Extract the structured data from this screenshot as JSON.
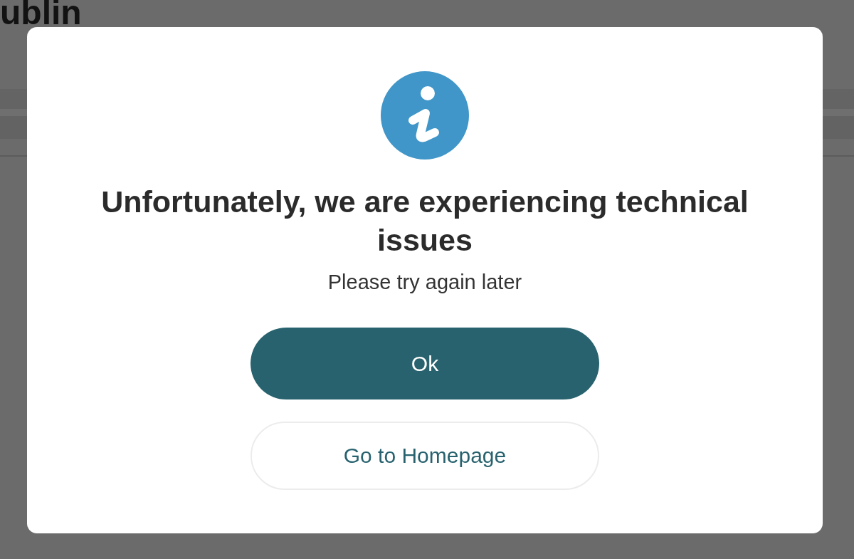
{
  "background_page": {
    "logo_text": "ublin"
  },
  "dialog": {
    "title": "Unfortunately, we are experiencing technical issues",
    "message": "Please try again later",
    "buttons": [
      {
        "label": "Ok",
        "kind": "primary"
      },
      {
        "label": "Go to Homepage",
        "kind": "secondary"
      }
    ]
  }
}
